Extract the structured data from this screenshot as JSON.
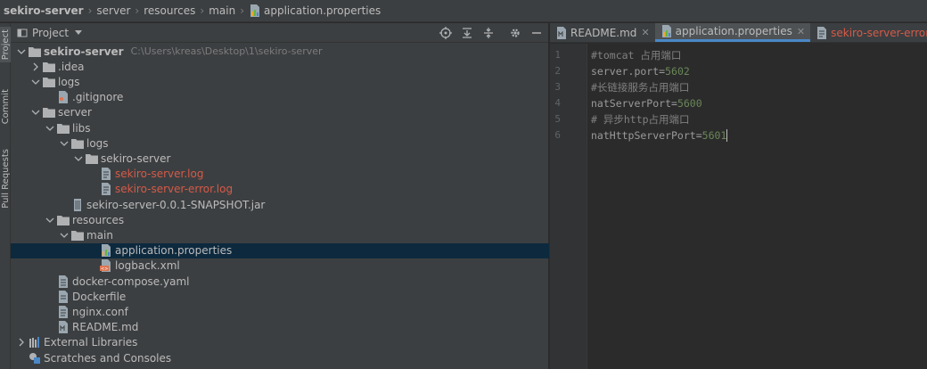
{
  "breadcrumb": [
    "sekiro-server",
    "server",
    "resources",
    "main",
    "application.properties"
  ],
  "sidestrip": {
    "project": "Project",
    "commit": "Commit",
    "pull_requests": "Pull Requests"
  },
  "project_panel": {
    "title": "Project",
    "tree": [
      {
        "label": "sekiro-server",
        "path": "C:\\Users\\kreas\\Desktop\\1\\sekiro-server",
        "depth": 0,
        "expanded": true,
        "icon": "folder",
        "bold": true
      },
      {
        "label": ".idea",
        "depth": 1,
        "expanded": false,
        "icon": "folder"
      },
      {
        "label": "logs",
        "depth": 1,
        "expanded": true,
        "icon": "folder"
      },
      {
        "label": ".gitignore",
        "depth": 2,
        "icon": "gitignore-file"
      },
      {
        "label": "server",
        "depth": 1,
        "expanded": true,
        "icon": "folder"
      },
      {
        "label": "libs",
        "depth": 2,
        "expanded": true,
        "icon": "folder"
      },
      {
        "label": "logs",
        "depth": 3,
        "expanded": true,
        "icon": "folder"
      },
      {
        "label": "sekiro-server",
        "depth": 4,
        "expanded": true,
        "icon": "folder"
      },
      {
        "label": "sekiro-server.log",
        "depth": 5,
        "icon": "log-file",
        "red": true
      },
      {
        "label": "sekiro-server-error.log",
        "depth": 5,
        "icon": "log-file",
        "red": true
      },
      {
        "label": "sekiro-server-0.0.1-SNAPSHOT.jar",
        "depth": 3,
        "icon": "jar-file"
      },
      {
        "label": "resources",
        "depth": 2,
        "expanded": true,
        "icon": "folder"
      },
      {
        "label": "main",
        "depth": 3,
        "expanded": true,
        "icon": "folder"
      },
      {
        "label": "application.properties",
        "depth": 5,
        "icon": "properties-file",
        "selected": true
      },
      {
        "label": "logback.xml",
        "depth": 5,
        "icon": "xml-file"
      },
      {
        "label": "docker-compose.yaml",
        "depth": 2,
        "icon": "yaml-file"
      },
      {
        "label": "Dockerfile",
        "depth": 2,
        "icon": "docker-file"
      },
      {
        "label": "nginx.conf",
        "depth": 2,
        "icon": "text-file"
      },
      {
        "label": "README.md",
        "depth": 2,
        "icon": "markdown-file"
      },
      {
        "label": "External Libraries",
        "depth": 0,
        "expanded": false,
        "icon": "libraries"
      },
      {
        "label": "Scratches and Consoles",
        "depth": 0,
        "icon": "scratches"
      }
    ]
  },
  "editor": {
    "tabs": [
      {
        "label": "README.md",
        "icon": "markdown-file",
        "active": false,
        "red": false
      },
      {
        "label": "application.properties",
        "icon": "properties-file",
        "active": true,
        "red": false
      },
      {
        "label": "sekiro-server-error.log",
        "icon": "log-file",
        "active": false,
        "red": true
      }
    ],
    "lines": [
      {
        "num": "1",
        "parts": [
          {
            "t": "#tomcat 占用端口",
            "c": "comment"
          }
        ]
      },
      {
        "num": "2",
        "parts": [
          {
            "t": "server.port",
            "c": "key"
          },
          {
            "t": "=",
            "c": "key"
          },
          {
            "t": "5602",
            "c": "value"
          }
        ]
      },
      {
        "num": "3",
        "parts": [
          {
            "t": "#长链接服务占用端口",
            "c": "comment"
          }
        ]
      },
      {
        "num": "4",
        "parts": [
          {
            "t": "natServerPort",
            "c": "key"
          },
          {
            "t": "=",
            "c": "key"
          },
          {
            "t": "5600",
            "c": "value"
          }
        ]
      },
      {
        "num": "5",
        "parts": [
          {
            "t": "# 异步http占用端口",
            "c": "comment"
          }
        ]
      },
      {
        "num": "6",
        "parts": [
          {
            "t": "natHttpServerPort",
            "c": "key"
          },
          {
            "t": "=",
            "c": "key"
          },
          {
            "t": "5601",
            "c": "value"
          }
        ],
        "caret": true
      }
    ]
  },
  "colors": {
    "bg_panel": "#3c3f41",
    "bg_editor": "#2b2b2b",
    "selected_row": "#0d293e",
    "red_file": "#d55a48",
    "accent": "#4a88c7"
  }
}
